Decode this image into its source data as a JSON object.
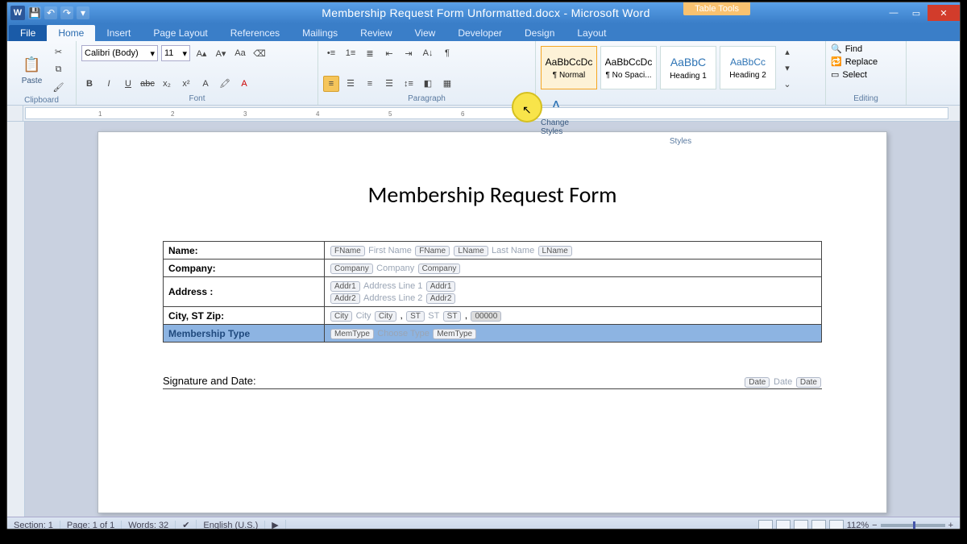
{
  "title": "Membership Request Form Unformatted.docx - Microsoft Word",
  "table_tools_label": "Table Tools",
  "tabs": {
    "file": "File",
    "home": "Home",
    "insert": "Insert",
    "page_layout": "Page Layout",
    "references": "References",
    "mailings": "Mailings",
    "review": "Review",
    "view": "View",
    "developer": "Developer",
    "design": "Design",
    "layout": "Layout"
  },
  "ribbon": {
    "clipboard": {
      "title": "Clipboard",
      "paste": "Paste"
    },
    "font": {
      "title": "Font",
      "name": "Calibri (Body)",
      "size": "11"
    },
    "paragraph": {
      "title": "Paragraph"
    },
    "styles": {
      "title": "Styles",
      "items": [
        {
          "preview": "AaBbCcDc",
          "label": "¶ Normal"
        },
        {
          "preview": "AaBbCcDc",
          "label": "¶ No Spaci..."
        },
        {
          "preview": "AaBbC",
          "label": "Heading 1"
        },
        {
          "preview": "AaBbCc",
          "label": "Heading 2"
        }
      ],
      "change": "Change Styles"
    },
    "editing": {
      "title": "Editing",
      "find": "Find",
      "replace": "Replace",
      "select": "Select"
    }
  },
  "doc": {
    "heading": "Membership Request Form",
    "rows": {
      "name": {
        "label": "Name:",
        "tags": [
          "FName",
          "FName",
          "LName",
          "LName"
        ],
        "placeholders": [
          "First Name",
          "Last Name"
        ]
      },
      "company": {
        "label": "Company:",
        "tags": [
          "Company",
          "Company"
        ],
        "placeholder": "Company"
      },
      "address": {
        "label": "Address :",
        "tags1": [
          "Addr1",
          "Addr1"
        ],
        "placeholder1": "Address Line 1",
        "tags2": [
          "Addr2",
          "Addr2"
        ],
        "placeholder2": "Address Line 2"
      },
      "city": {
        "label": "City, ST Zip:",
        "tags": [
          "City",
          "City",
          "ST",
          "ST"
        ],
        "pcity": "City",
        "pst": "ST",
        "zip": "00000",
        "comma": ","
      },
      "memtype": {
        "label": "Membership Type",
        "tags": [
          "MemType",
          "MemType"
        ],
        "placeholder": "Choose Type"
      }
    },
    "signature": {
      "label": "Signature and Date:",
      "date_tag": "Date",
      "date_placeholder": "Date"
    }
  },
  "status": {
    "section": "Section: 1",
    "page": "Page: 1 of 1",
    "words": "Words: 32",
    "lang": "English (U.S.)",
    "zoom": "112%"
  }
}
